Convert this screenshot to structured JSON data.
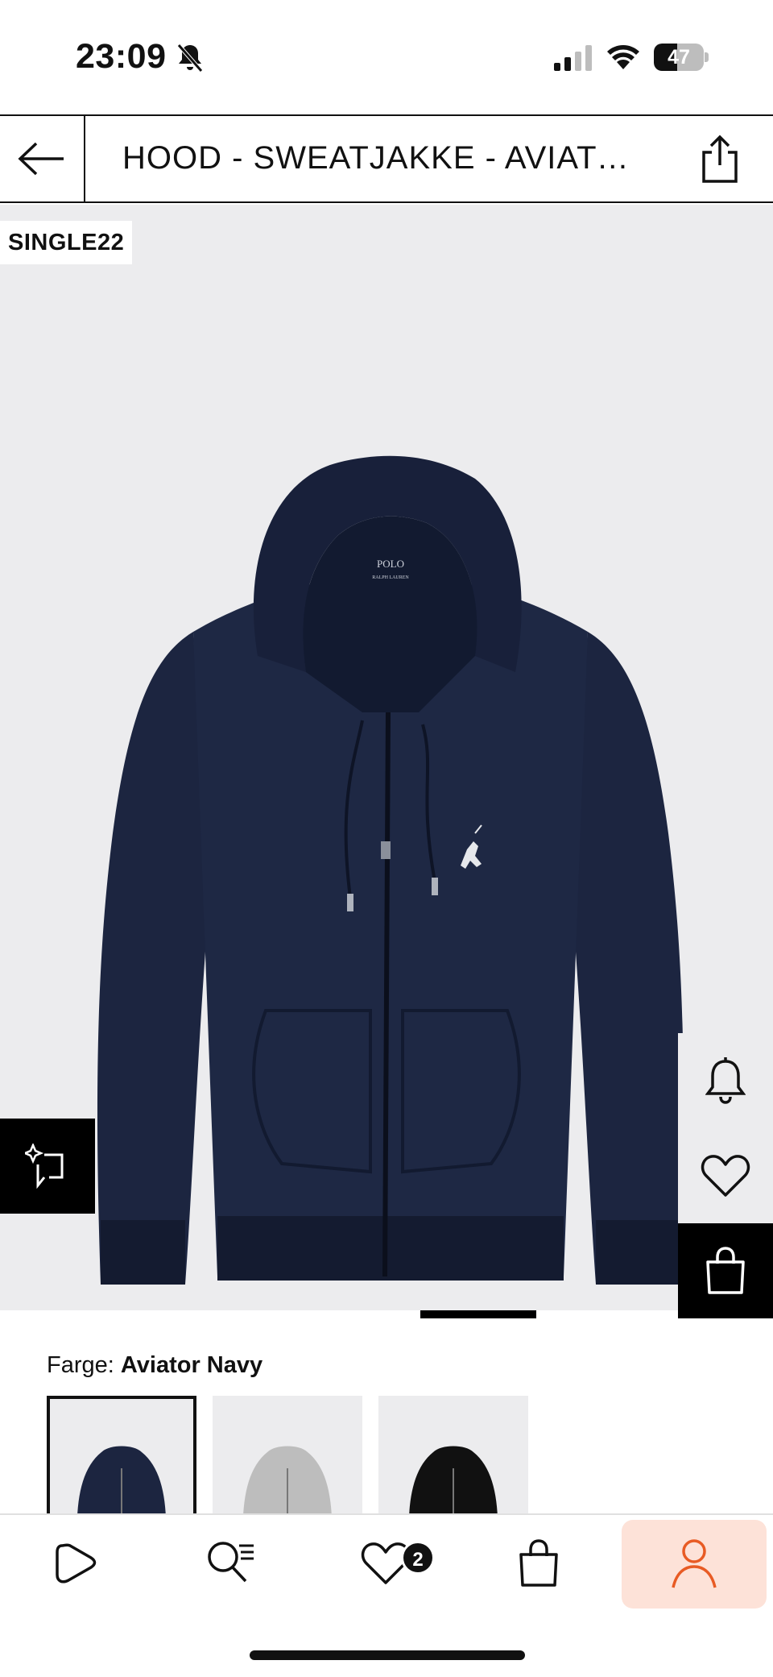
{
  "status_bar": {
    "time": "23:09",
    "battery_percent": "47",
    "battery_level": 0.47
  },
  "header": {
    "title": "HOOD - SWEATJAKKE - AVIATOR..."
  },
  "product": {
    "promo_badge": "SINGLE22",
    "image_brand": "POLO",
    "image_brand_sub": "RALPH LAUREN",
    "carousel_position": 0.55
  },
  "color": {
    "label": "Farge:",
    "selected": "Aviator Navy",
    "swatches": [
      {
        "name": "Aviator Navy",
        "color": "#1c2540",
        "selected": true
      },
      {
        "name": "Grey",
        "color": "#bdbdbd",
        "selected": false
      },
      {
        "name": "Black",
        "color": "#111111",
        "selected": false
      }
    ]
  },
  "bottom_nav": {
    "items": [
      "home",
      "search",
      "wishlist",
      "cart",
      "profile"
    ],
    "wishlist_count": "2",
    "active": "profile"
  },
  "colors": {
    "accent": "#e85b24",
    "profile_bg": "#fde2d8",
    "image_bg": "#ececee"
  },
  "icons": {
    "back": "arrow-left-icon",
    "share": "share-icon",
    "bell": "bell-icon",
    "heart": "heart-icon",
    "bag": "shopping-bag-icon",
    "ai": "sparkle-crop-icon"
  }
}
